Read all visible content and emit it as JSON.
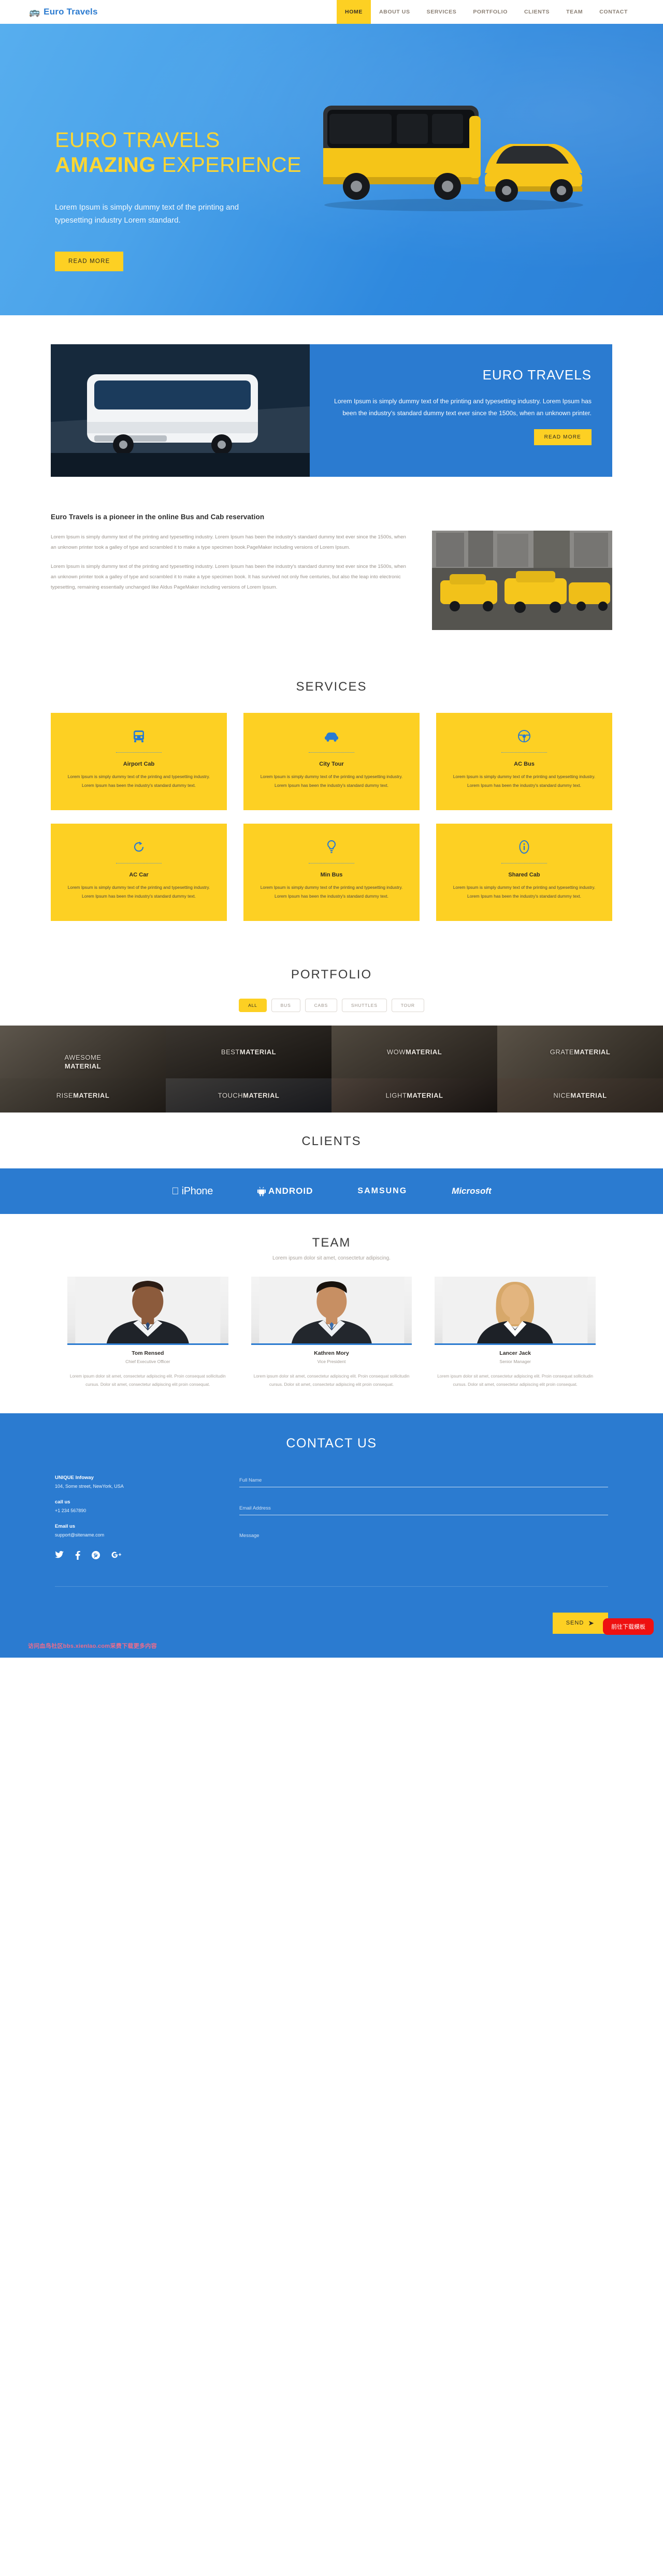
{
  "brand": {
    "icon": "bus-icon",
    "name": "Euro Travels"
  },
  "nav": {
    "items": [
      {
        "label": "HOME",
        "active": true
      },
      {
        "label": "ABOUT US",
        "active": false
      },
      {
        "label": "SERVICES",
        "active": false
      },
      {
        "label": "PORTFOLIO",
        "active": false
      },
      {
        "label": "CLIENTS",
        "active": false
      },
      {
        "label": "TEAM",
        "active": false
      },
      {
        "label": "CONTACT",
        "active": false
      }
    ]
  },
  "hero": {
    "title_line1": "EURO TRAVELS",
    "title_line2_bold": "AMAZING",
    "title_line2_rest": " EXPERIENCE",
    "paragraph": "Lorem Ipsum is simply dummy text of the printing and typesetting industry Lorem standard.",
    "cta": "READ MORE"
  },
  "promo": {
    "title": "EURO TRAVELS",
    "text": "Lorem Ipsum is simply dummy text of the printing and typesetting industry. Lorem Ipsum has been the industry's standard dummy text ever since the 1500s, when an unknown printer.",
    "cta": "READ MORE"
  },
  "about": {
    "heading": "Euro Travels is a pioneer in the online Bus and Cab reservation",
    "paragraph1": "Lorem Ipsum is simply dummy text of the printing and typesetting industry. Lorem Ipsum has been the industry's standard dummy text ever since the 1500s, when an unknown printer took a galley of type and scrambled it to make a type specimen book.PageMaker including versions of Lorem Ipsum.",
    "paragraph2": "Lorem Ipsum is simply dummy text of the printing and typesetting industry. Lorem Ipsum has been the industry's standard dummy text ever since the 1500s, when an unknown printer took a galley of type and scrambled it to make a type specimen book. It has survived not only five centuries, but also the leap into electronic typesetting, remaining essentially unchanged like Aldus PageMaker including versions of Lorem Ipsum."
  },
  "services": {
    "title": "SERVICES",
    "cards": [
      {
        "icon": "bus-icon",
        "name": "Airport Cab",
        "desc": "Lorem Ipsum is simply dummy text of the printing and typesetting industry. Lorem Ipsum has been the industry's standard dummy text."
      },
      {
        "icon": "car-icon",
        "name": "City Tour",
        "desc": "Lorem Ipsum is simply dummy text of the printing and typesetting industry. Lorem Ipsum has been the industry's standard dummy text."
      },
      {
        "icon": "steering-icon",
        "name": "AC Bus",
        "desc": "Lorem Ipsum is simply dummy text of the printing and typesetting industry. Lorem Ipsum has been the industry's standard dummy text."
      },
      {
        "icon": "refresh-icon",
        "name": "AC Car",
        "desc": "Lorem Ipsum is simply dummy text of the printing and typesetting industry. Lorem Ipsum has been the industry's standard dummy text."
      },
      {
        "icon": "lightbulb-icon",
        "name": "Min Bus",
        "desc": "Lorem Ipsum is simply dummy text of the printing and typesetting industry. Lorem Ipsum has been the industry's standard dummy text."
      },
      {
        "icon": "info-icon",
        "name": "Shared Cab",
        "desc": "Lorem Ipsum is simply dummy text of the printing and typesetting industry. Lorem Ipsum has been the industry's standard dummy text."
      }
    ]
  },
  "portfolio": {
    "title": "PORTFOLIO",
    "filters": [
      {
        "label": "ALL",
        "active": true
      },
      {
        "label": "BUS",
        "active": false
      },
      {
        "label": "CABS",
        "active": false
      },
      {
        "label": "SHUTTLES",
        "active": false
      },
      {
        "label": "TOUR",
        "active": false
      }
    ],
    "row1": [
      {
        "light": "AWESOME",
        "bold": "MATERIAL"
      },
      {
        "light": "BEST",
        "bold": "MATERIAL"
      },
      {
        "light": "WOW",
        "bold": "MATERIAL"
      },
      {
        "light": "GRATE",
        "bold": "MATERIAL"
      }
    ],
    "row2": [
      {
        "light": "RISE",
        "bold": "MATERIAL"
      },
      {
        "light": "TOUCH",
        "bold": "MATERIAL"
      },
      {
        "light": "LIGHT",
        "bold": "MATERIAL"
      },
      {
        "light": "NICE",
        "bold": "MATERIAL"
      }
    ]
  },
  "clients": {
    "title": "CLIENTS",
    "logos": [
      {
        "name": "iPhone",
        "icon": "apple-icon"
      },
      {
        "name": "ANDROID",
        "icon": "android-icon"
      },
      {
        "name": "SAMSUNG",
        "icon": ""
      },
      {
        "name": "Microsoft",
        "icon": ""
      }
    ]
  },
  "team": {
    "title": "TEAM",
    "subtitle": "Lorem ipsum dolor sit amet, consectetur adipiscing.",
    "members": [
      {
        "name": "Tom Rensed",
        "role": "Chief Executive Officer",
        "bio": "Lorem ipsum dolor sit amet, consectetur adipiscing elit. Proin consequat sollicitudin cursus. Dolor sit amet, consectetur adipiscing elit proin consequat."
      },
      {
        "name": "Kathren Mory",
        "role": "Vice President",
        "bio": "Lorem ipsum dolor sit amet, consectetur adipiscing elit. Proin consequat sollicitudin cursus. Dolor sit amet, consectetur adipiscing elit proin consequat."
      },
      {
        "name": "Lancer Jack",
        "role": "Senior Manager",
        "bio": "Lorem ipsum dolor sit amet, consectetur adipiscing elit. Proin consequat sollicitudin cursus. Dolor sit amet, consectetur adipiscing elit proin consequat."
      }
    ]
  },
  "contact": {
    "title": "CONTACT US",
    "company_label": "UNIQUE Infoway",
    "address": "104, Some street, NewYork, USA",
    "call_label": "call us",
    "phone": "+1 234 567890",
    "email_label": "Email us",
    "email": "support@sitename.com",
    "socials": [
      "twitter-icon",
      "facebook-icon",
      "pinterest-icon",
      "google-plus-icon"
    ],
    "form": {
      "name_placeholder": "Full Name",
      "name_value": "",
      "email_placeholder": "Email Address",
      "email_value": "",
      "message_placeholder": "Message",
      "message_value": "",
      "submit": "SEND",
      "submit_arrow": "➤"
    }
  },
  "overlay": {
    "download_button": "前往下载模板"
  },
  "footer": {
    "note": "访问血鸟社区bbs.xienIao.com采费下载更多内容"
  },
  "colors": {
    "brand_blue": "#2b7bd0",
    "accent_yellow": "#fdd023",
    "hero_blue": "#4ba3ea",
    "muted_text": "#9a938c",
    "red": "#ee1111"
  }
}
